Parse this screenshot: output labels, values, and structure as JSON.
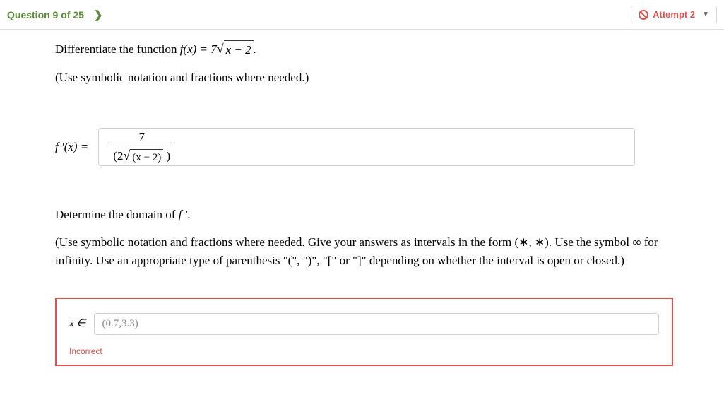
{
  "header": {
    "question_label": "Question 9 of 25",
    "attempt_label": "Attempt 2"
  },
  "problem": {
    "intro_prefix": "Differentiate the function ",
    "func_lhs": "f(x) = 7",
    "sqrt_inner": "x − 2",
    "period": ".",
    "note1": "(Use symbolic notation and fractions where needed.)"
  },
  "answer1": {
    "lhs": "f ′(x) =",
    "num": "7",
    "den_prefix": "(2",
    "den_sqrt_inner": "(x − 2)",
    "den_suffix": " )"
  },
  "part2": {
    "prompt_prefix": "Determine the domain of ",
    "prompt_sym": "f ′",
    "prompt_suffix": ".",
    "note2": "(Use symbolic notation and fractions where needed. Give your answers as intervals in the form (∗, ∗). Use the symbol ∞ for infinity. Use an appropriate type of parenthesis \"(\", \")\", \"[\" or \"]\" depending on whether the interval is open or closed.)"
  },
  "answer2": {
    "lhs": "x ∈",
    "value": "(0.7,3.3)",
    "status": "Incorrect"
  }
}
